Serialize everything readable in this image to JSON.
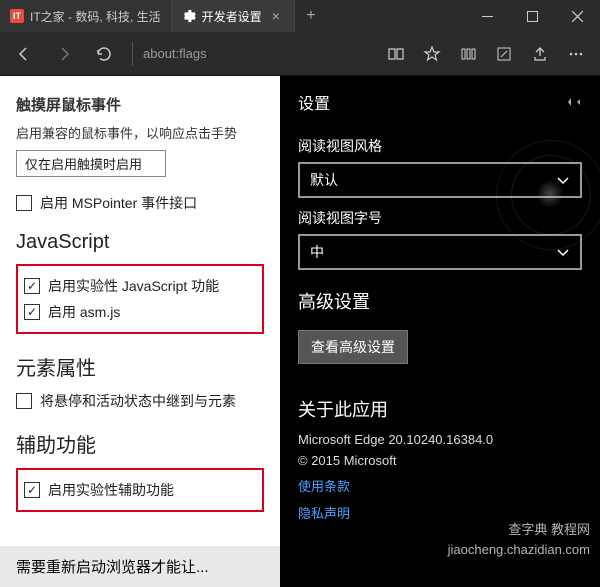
{
  "titlebar": {
    "tabs": [
      {
        "label": "IT之家 - 数码, 科技, 生活",
        "icon_text": "IT"
      },
      {
        "label": "开发者设置"
      }
    ],
    "new_tab": "+"
  },
  "toolbar": {
    "address": "about:flags"
  },
  "flags": {
    "section_touch_title": "触摸屏鼠标事件",
    "touch_desc": "启用兼容的鼠标事件，以响应点击手势",
    "touch_select_value": "仅在启用触摸时启用",
    "mspointer_label": "启用 MSPointer 事件接口",
    "js_title": "JavaScript",
    "js_experimental_label": "启用实验性 JavaScript 功能",
    "asmjs_label": "启用 asm.js",
    "element_attrs_title": "元素属性",
    "relay_label": "将悬停和活动状态中继到与元素",
    "accessibility_title": "辅助功能",
    "accessibility_experimental_label": "启用实验性辅助功能",
    "restart_notice": "需要重新启动浏览器才能让..."
  },
  "settings": {
    "panel_title": "设置",
    "reading_style_label": "阅读视图风格",
    "reading_style_value": "默认",
    "reading_font_label": "阅读视图字号",
    "reading_font_value": "中",
    "advanced_title": "高级设置",
    "advanced_button": "查看高级设置",
    "about_title": "关于此应用",
    "version": "Microsoft Edge 20.10240.16384.0",
    "copyright": "© 2015 Microsoft",
    "terms_link": "使用条款",
    "privacy_link": "隐私声明"
  },
  "watermark": {
    "line1": "查字典 教程网",
    "line2": "jiaocheng.chazidian.com"
  },
  "icons": {
    "check": "✓",
    "chevron_down": "⌄"
  }
}
